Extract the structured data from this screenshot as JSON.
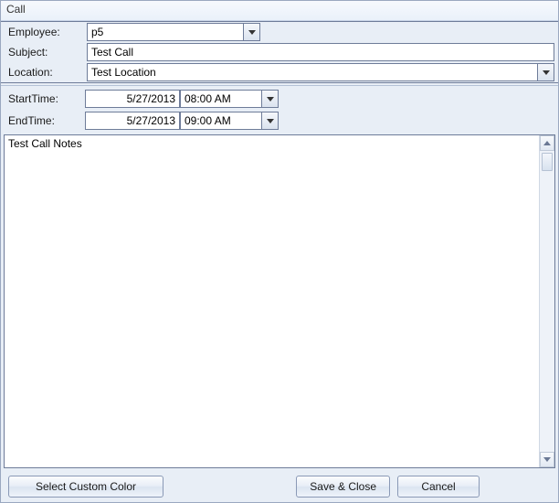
{
  "window": {
    "title": "Call"
  },
  "fields": {
    "employee_label": "Employee:",
    "employee_value": "p5",
    "subject_label": "Subject:",
    "subject_value": "Test Call",
    "location_label": "Location:",
    "location_value": "Test Location"
  },
  "times": {
    "start_label": "StartTime:",
    "start_date": "5/27/2013",
    "start_time": "08:00 AM",
    "end_label": "EndTime:",
    "end_date": "5/27/2013",
    "end_time": "09:00 AM"
  },
  "notes": {
    "value": "Test Call Notes"
  },
  "buttons": {
    "custom_color": "Select Custom Color",
    "save_close": "Save & Close",
    "cancel": "Cancel"
  }
}
